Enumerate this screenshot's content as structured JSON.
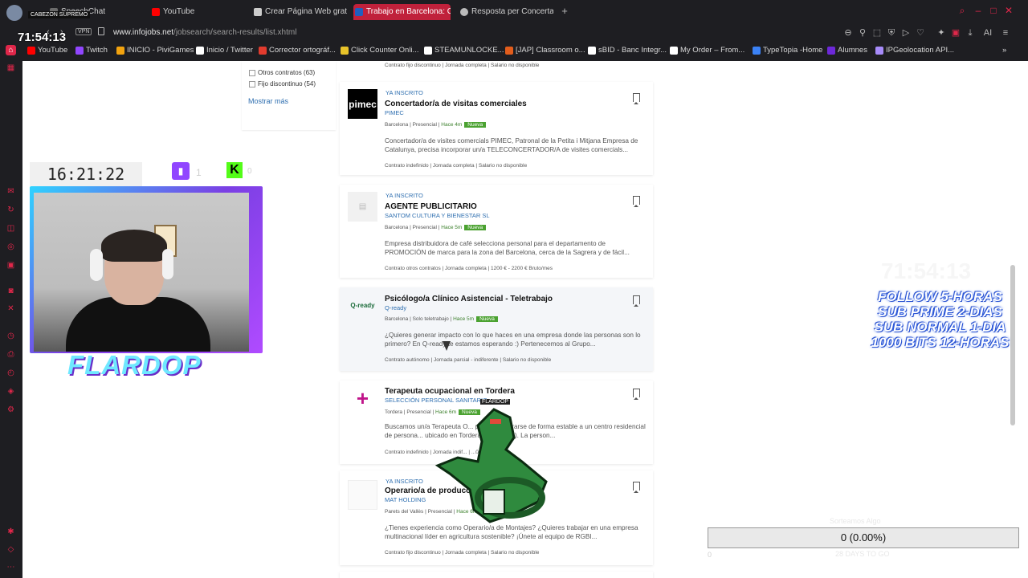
{
  "browser": {
    "tabs": [
      {
        "label": "SpeechChat",
        "color": "#6b6b6b"
      },
      {
        "label": "YouTube",
        "color": "#ff0000"
      },
      {
        "label": "Crear Página Web gratis",
        "color": "#cccccc"
      },
      {
        "label": "Trabajo en Barcelona: Ofe",
        "color": "#1f5fbf",
        "active": true
      },
      {
        "label": "Resposta per Concertador",
        "color": "#bbbbbb"
      }
    ],
    "new_tab": "+",
    "vpn_badge": "VPN",
    "url_host": "www.infojobs.net",
    "url_path": "/jobsearch/search-results/list.xhtml",
    "ai_label": "AI",
    "bookmarks": [
      {
        "label": "YouTube",
        "color": "#ff0000"
      },
      {
        "label": "Twitch",
        "color": "#9146ff"
      },
      {
        "label": "INICIO - PiviGames",
        "color": "#f2a30f"
      },
      {
        "label": "Inicio / Twitter",
        "color": "#ffffff"
      },
      {
        "label": "Corrector ortográf...",
        "color": "#e23b2e"
      },
      {
        "label": "Click Counter Onli...",
        "color": "#e8c32a"
      },
      {
        "label": "STEAMUNLOCKE...",
        "color": "#ffffff"
      },
      {
        "label": "[JAP] Classroom o...",
        "color": "#e35d1c"
      },
      {
        "label": "sBID - Banc Integr...",
        "color": "#ffffff"
      },
      {
        "label": "My Order – From...",
        "color": "#ffffff"
      },
      {
        "label": "TypeTopia -Home",
        "color": "#3b82f6"
      },
      {
        "label": "Alumnes",
        "color": "#6d28d9"
      },
      {
        "label": "IPGeolocation API...",
        "color": "#a78bfa"
      }
    ],
    "more_bookmarks": "»"
  },
  "filters": {
    "options": [
      "Otros contratos (63)",
      "Fijo discontinuo (54)"
    ],
    "show_more": "Mostrar más",
    "top_crumb_1": "Contrato fijo discontinuo",
    "top_crumb_2": "Jornada completa",
    "top_crumb_3": "Salario no disponible"
  },
  "offers": [
    {
      "applied": "YA INSCRITO",
      "logo": "pimec",
      "title": "Concertador/a de visitas comerciales",
      "company": "PIMEC",
      "city": "Barcelona",
      "mode": "Presencial",
      "ago": "Hace 4m",
      "badge": "Nueva",
      "desc": "Concertador/a de visites comercials PIMEC, Patronal de la Petita i Mitjana Empresa de Catalunya, precisa incorporar un/a TELECONCERTADOR/A de visites comercials...",
      "contract": "Contrato indefinido",
      "schedule": "Jornada completa",
      "salary": "Salario no disponible"
    },
    {
      "applied": "YA INSCRITO",
      "logo": "",
      "title": "AGENTE PUBLICITARIO",
      "company": "SANTOM CULTURA Y BIENESTAR SL",
      "city": "Barcelona",
      "mode": "Presencial",
      "ago": "Hace 5m",
      "badge": "Nueva",
      "desc": "Empresa distribuidora de café selecciona personal para el departamento de PROMOCIÓN de marca para la zona del Barcelona, cerca de la Sagrera y de fácil...",
      "contract": "Contrato otros contratos",
      "schedule": "Jornada completa",
      "salary": "1200 € - 2200 € Bruto/mes"
    },
    {
      "applied": "",
      "logo": "Q-ready",
      "title": "Psicólogo/a Clínico Asistencial - Teletrabajo",
      "company": "Q-ready",
      "city": "Barcelona",
      "mode": "Solo teletrabajo",
      "ago": "Hace 5m",
      "badge": "Nueva",
      "desc": "¿Quieres generar impacto con lo que haces en una empresa donde las personas son lo primero? En Q-ready te estamos esperando :) Pertenecemos al Grupo...",
      "contract": "Contrato autónomo",
      "schedule": "Jornada parcial - indiferente",
      "salary": "Salario no disponible"
    },
    {
      "applied": "",
      "logo": "+",
      "title": "Terapeuta ocupacional en Tordera",
      "company": "SELECCIÓN PERSONAL SANITARIO",
      "city": "Tordera",
      "mode": "Presencial",
      "ago": "Hace 6m",
      "badge": "Nueva",
      "desc": "Buscamos un/a Terapeuta O... para incorporarse de forma estable a un centro residencial de persona... ubicado en Tordera (Barcelona). La person...",
      "contract": "Contrato indefinido",
      "schedule": "Jornada indif...",
      "salary": "...00 € Bruto/año"
    },
    {
      "applied": "YA INSCRITO",
      "logo": "",
      "title": "Operario/a de producc... disconti...",
      "company": "MAT HOLDING",
      "city": "Parets del Vallès",
      "mode": "Presencial",
      "ago": "Hace 6m",
      "badge": "",
      "desc": "¿Tienes experiencia como Operario/a de Montajes? ¿Quieres trabajar en una empresa multinacional líder en agricultura sostenible? ¡Únete al equipo de RGBI...",
      "contract": "Contrato fijo discontinuo",
      "schedule": "Jornada completa",
      "salary": "Salario no disponible"
    }
  ],
  "overlay": {
    "stream_clock": "71:54:13",
    "top_badge": "CABEZON SUPREMO",
    "cam_clock": "16:21:22",
    "twitch_count": "1",
    "kick_count": "0",
    "streamer_name": "FLARDOP",
    "ghost_clock": "71:54:13",
    "follow_lines": [
      "FOLLOW 5-HORAS",
      "SUB PRIME 2-DIAS",
      "SUB NORMAL 1-DIA",
      "1000 BITS 12-HORAS"
    ],
    "goal_title": "Sorteamos Algo",
    "goal_value": "0 (0.00%)",
    "goal_left": "0",
    "goal_right": "20",
    "goal_date": "28 DAYS TO GO",
    "sprite_tag": "FLARDOP"
  },
  "colors": {
    "accent": "#c0213b",
    "link": "#2f6fb0",
    "new_badge": "#4ba231"
  }
}
